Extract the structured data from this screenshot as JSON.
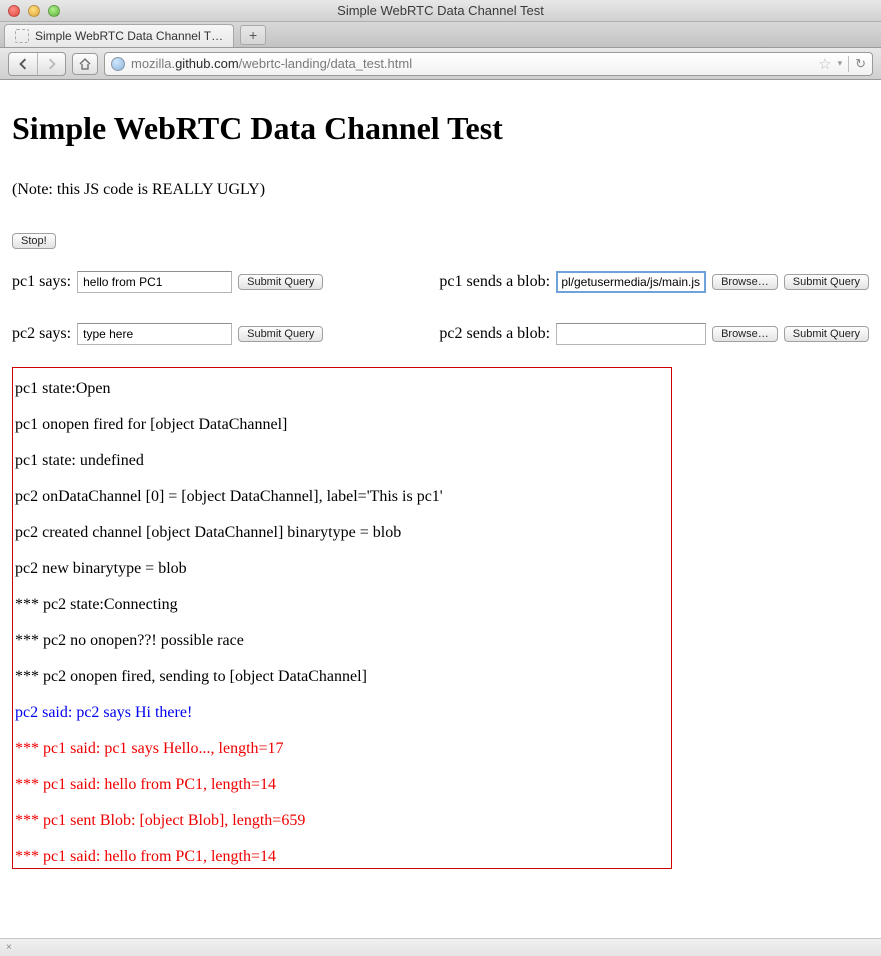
{
  "window": {
    "title": "Simple WebRTC Data Channel Test"
  },
  "tab": {
    "title": "Simple WebRTC Data Channel T…"
  },
  "url": {
    "prefix": "mozilla.",
    "host": "github.com",
    "path": "/webrtc-landing/data_test.html"
  },
  "page": {
    "heading": "Simple WebRTC Data Channel Test",
    "note": "(Note: this JS code is REALLY UGLY)",
    "stop_label": "Stop!"
  },
  "form": {
    "pc1_says_label": "pc1 says:",
    "pc1_says_value": "hello from PC1",
    "pc2_says_label": "pc2 says:",
    "pc2_says_value": "type here",
    "pc1_blob_label": "pc1 sends a blob:",
    "pc1_blob_file": "ipl/getusermedia/js/main.js",
    "pc2_blob_label": "pc2 sends a blob:",
    "pc2_blob_file": "",
    "submit_label": "Submit Query",
    "browse_label": "Browse…"
  },
  "log": [
    {
      "text": "pc1 state:Open",
      "cls": ""
    },
    {
      "text": "pc1 onopen fired for [object DataChannel]",
      "cls": ""
    },
    {
      "text": "pc1 state: undefined",
      "cls": ""
    },
    {
      "text": "pc2 onDataChannel [0] = [object DataChannel], label='This is pc1'",
      "cls": ""
    },
    {
      "text": "pc2 created channel [object DataChannel] binarytype = blob",
      "cls": ""
    },
    {
      "text": "pc2 new binarytype = blob",
      "cls": ""
    },
    {
      "text": "*** pc2 state:Connecting",
      "cls": ""
    },
    {
      "text": "*** pc2 no onopen??! possible race",
      "cls": ""
    },
    {
      "text": "*** pc2 onopen fired, sending to [object DataChannel]",
      "cls": ""
    },
    {
      "text": "pc2 said: pc2 says Hi there!",
      "cls": "log-blue"
    },
    {
      "text": "*** pc1 said: pc1 says Hello..., length=17",
      "cls": "log-red"
    },
    {
      "text": "*** pc1 said: hello from PC1, length=14",
      "cls": "log-red"
    },
    {
      "text": "*** pc1 sent Blob: [object Blob], length=659",
      "cls": "log-red"
    },
    {
      "text": "*** pc1 said: hello from PC1, length=14",
      "cls": "log-red"
    }
  ],
  "statusbar": {
    "text": "×"
  }
}
